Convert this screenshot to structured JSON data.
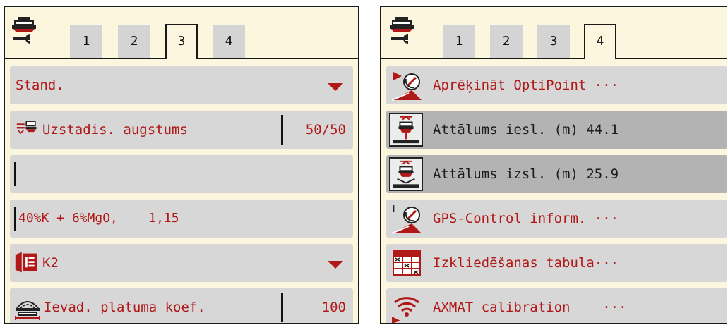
{
  "left_panel": {
    "tabs": [
      "1",
      "2",
      "3",
      "4"
    ],
    "active_tab": "3",
    "rows": {
      "mode": "Stand.",
      "height_label": "Uzstadis. augstums",
      "height_value": "50/50",
      "fertilizer": "40%K + 6%MgO,    1,15",
      "disc_type": "K2",
      "width_label": "Ievad. platuma koef.",
      "width_value": "100"
    }
  },
  "right_panel": {
    "tabs": [
      "1",
      "2",
      "3",
      "4"
    ],
    "active_tab": "4",
    "rows": {
      "optipoint": "Aprēķināt OptiPoint ···",
      "dist_on": "Attālums iesl. (m) 44.1",
      "dist_off": "Attālums izsl. (m) 25.9",
      "gps_info": "GPS-Control inform. ···",
      "spread_table": "Izkliedēšanas tabula···",
      "axmat": "AXMAT calibration    ···"
    }
  },
  "colors": {
    "panel_bg": "#fbf6dd",
    "row_bg": "#d7d7d7",
    "row_selected": "#b3b3b3",
    "accent_red": "#b11818",
    "tab_bg": "#d4d4d4"
  },
  "icons": [
    "machine-wrench-icon",
    "dropdown-arrow-icon",
    "height-adjust-icon",
    "disc-type-icon",
    "width-factor-icon",
    "optipoint-calc-icon",
    "distance-on-icon",
    "distance-off-icon",
    "gps-info-icon",
    "spread-table-icon",
    "axmat-wifi-icon"
  ]
}
